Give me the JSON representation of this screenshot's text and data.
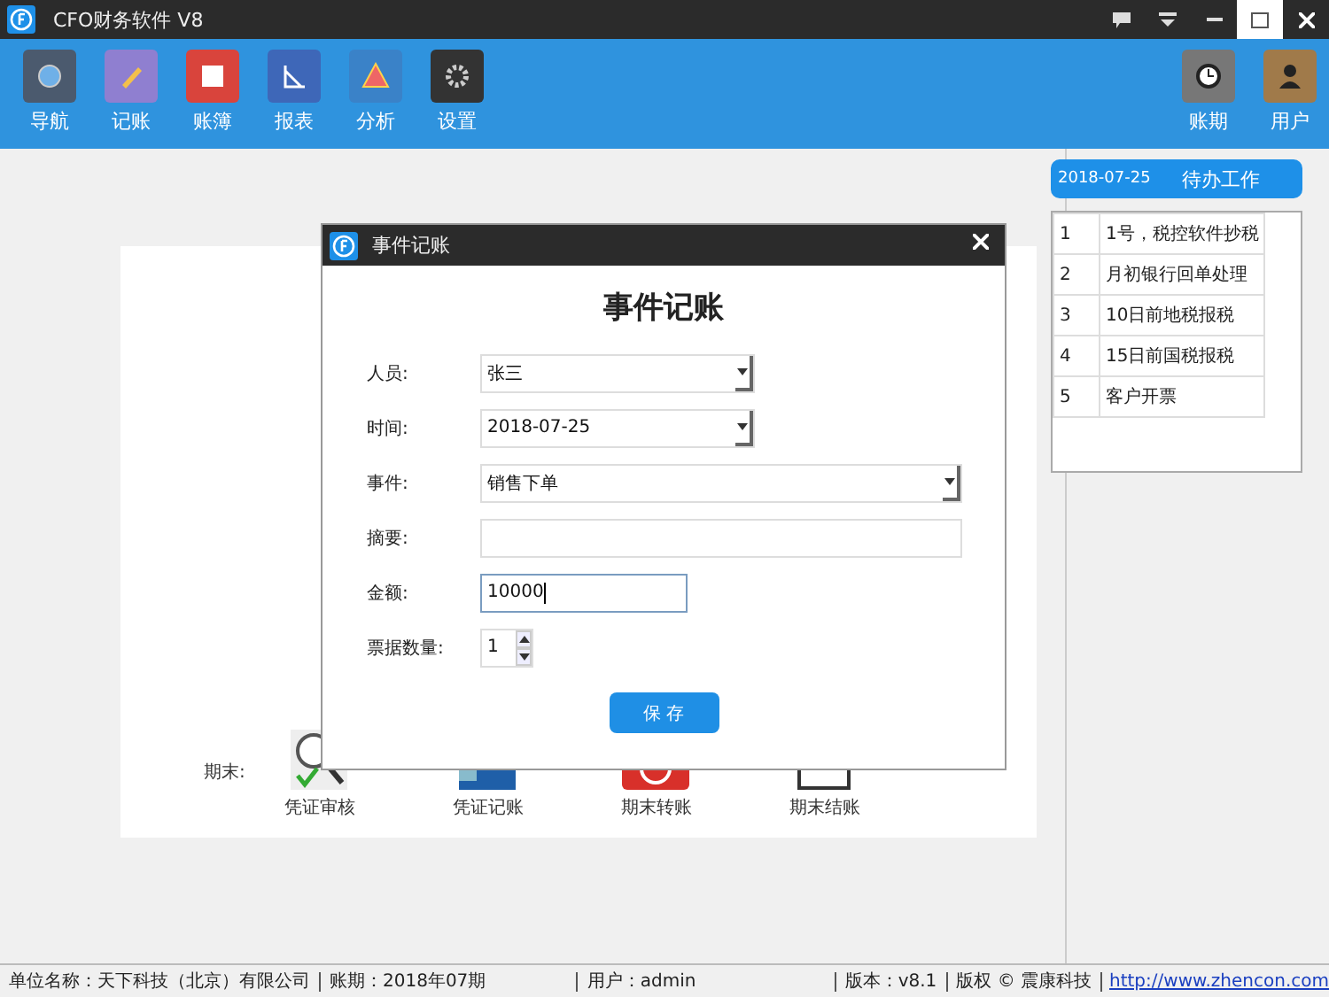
{
  "window": {
    "title": "CFO财务软件 V8"
  },
  "toolbar": {
    "items": [
      {
        "label": "导航",
        "kind": "nav"
      },
      {
        "label": "记账",
        "kind": "entry"
      },
      {
        "label": "账簿",
        "kind": "ledger"
      },
      {
        "label": "报表",
        "kind": "report"
      },
      {
        "label": "分析",
        "kind": "analysis"
      },
      {
        "label": "设置",
        "kind": "settings"
      }
    ],
    "right_items": [
      {
        "label": "账期",
        "kind": "period"
      },
      {
        "label": "用户",
        "kind": "user"
      }
    ]
  },
  "todo": {
    "date": "2018-07-25",
    "title": "待办工作",
    "rows": [
      {
        "no": "1",
        "text": "1号，税控软件抄税"
      },
      {
        "no": "2",
        "text": "月初银行回单处理"
      },
      {
        "no": "3",
        "text": "10日前地税报税"
      },
      {
        "no": "4",
        "text": "15日前国税报税"
      },
      {
        "no": "5",
        "text": "客户开票"
      }
    ]
  },
  "canvas": {
    "label": "期末:",
    "steps": [
      {
        "label": "凭证审核",
        "kind": "review"
      },
      {
        "label": "凭证记账",
        "kind": "post"
      },
      {
        "label": "期末转账",
        "kind": "transfer"
      },
      {
        "label": "期末结账",
        "kind": "close"
      }
    ]
  },
  "dialog": {
    "title": "事件记账",
    "heading": "事件记账",
    "fields": [
      {
        "label": "人员:",
        "kind": "select",
        "value": "张三",
        "wide": false
      },
      {
        "label": "时间:",
        "kind": "select",
        "value": "2018-07-25",
        "wide": false
      },
      {
        "label": "事件:",
        "kind": "select",
        "value": "销售下单",
        "wide": true
      },
      {
        "label": "摘要:",
        "kind": "text",
        "wide": true
      },
      {
        "label": "金额:",
        "kind": "text",
        "value": "10000",
        "wide": false,
        "focused": true
      },
      {
        "label": "票据数量:",
        "kind": "spinner",
        "value": "1"
      }
    ],
    "save": "保 存"
  },
  "status_bar": {
    "items": [
      "单位名称：天下科技（北京）有限公司",
      "账期：2018年07期",
      "用户：admin",
      "版本：v8.1",
      "版权 © 震康科技"
    ],
    "link": "http://www.zhencon.com"
  }
}
